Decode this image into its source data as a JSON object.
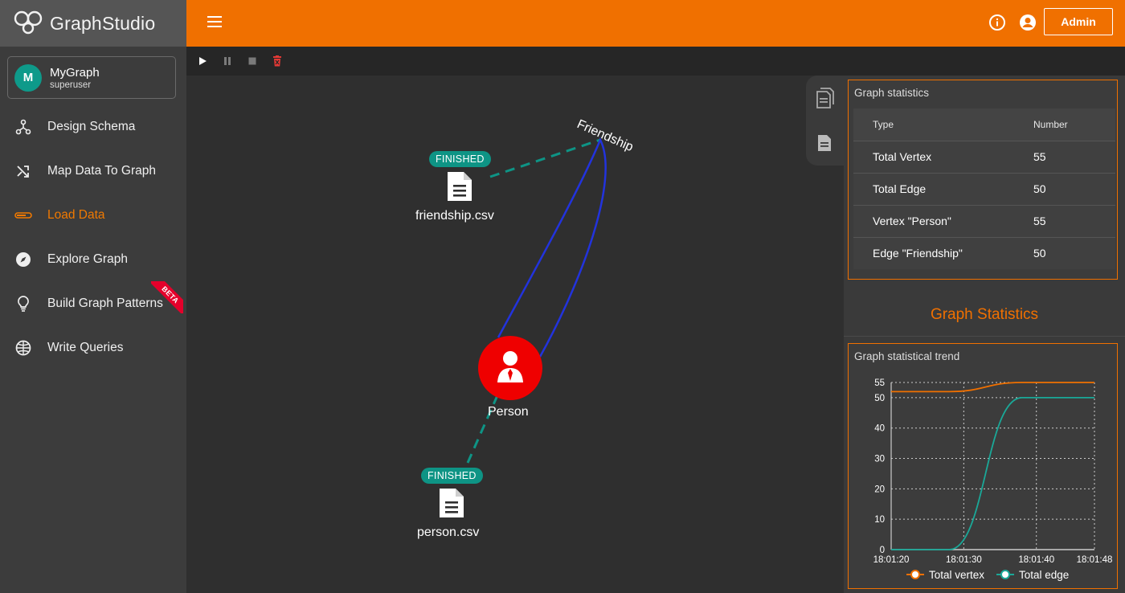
{
  "brand": {
    "name_light": "Graph",
    "name_bold": "Studio"
  },
  "graph_card": {
    "avatar_letter": "M",
    "name": "MyGraph",
    "role": "superuser"
  },
  "nav": {
    "items": [
      {
        "label": "Design Schema",
        "icon": "schema-icon"
      },
      {
        "label": "Map Data To Graph",
        "icon": "shuffle-icon"
      },
      {
        "label": "Load Data",
        "icon": "load-bar-icon",
        "active": true
      },
      {
        "label": "Explore Graph",
        "icon": "compass-icon"
      },
      {
        "label": "Build Graph Patterns",
        "icon": "lightbulb-icon",
        "badge": "BETA"
      },
      {
        "label": "Write Queries",
        "icon": "globe-icon"
      }
    ]
  },
  "topbar": {
    "admin_label": "Admin",
    "icons": [
      "menu-icon",
      "info-icon",
      "account-icon"
    ]
  },
  "toolbar": {
    "icons": [
      "play-icon",
      "pause-icon",
      "stop-icon",
      "delete-icon"
    ],
    "delete_color": "#e53935"
  },
  "canvas": {
    "edge_label": "Friendship",
    "vertex_label": "Person",
    "files": [
      {
        "name": "friendship.csv",
        "status": "FINISHED"
      },
      {
        "name": "person.csv",
        "status": "FINISHED"
      }
    ],
    "colors": {
      "vertex": "#ef0000",
      "edge": "#2233dd",
      "status": "#0e9485"
    }
  },
  "stats": {
    "title": "Graph statistics",
    "columns": [
      "Type",
      "Number"
    ],
    "rows": [
      {
        "type": "Total Vertex",
        "number": "55"
      },
      {
        "type": "Total Edge",
        "number": "50"
      },
      {
        "type": "Vertex \"Person\"",
        "number": "55"
      },
      {
        "type": "Edge \"Friendship\"",
        "number": "50"
      }
    ]
  },
  "panel_heading": "Graph Statistics",
  "trend": {
    "title": "Graph statistical trend",
    "legend": [
      "Total vertex",
      "Total edge"
    ]
  },
  "chart_data": {
    "type": "line",
    "title": "Graph statistical trend",
    "x_ticks": [
      "18:01:20",
      "18:01:30",
      "18:01:40",
      "18:01:48"
    ],
    "y_ticks": [
      0,
      10,
      20,
      30,
      40,
      50,
      55
    ],
    "ylim": [
      0,
      55
    ],
    "grid": true,
    "legend_position": "bottom",
    "series": [
      {
        "name": "Total vertex",
        "color": "#f07000",
        "x": [
          "18:01:20",
          "18:01:28",
          "18:01:38",
          "18:01:48"
        ],
        "values": [
          52,
          52,
          55,
          55
        ]
      },
      {
        "name": "Total edge",
        "color": "#1aa898",
        "x": [
          "18:01:20",
          "18:01:28",
          "18:01:38",
          "18:01:48"
        ],
        "values": [
          0,
          0,
          50,
          50
        ]
      }
    ]
  }
}
